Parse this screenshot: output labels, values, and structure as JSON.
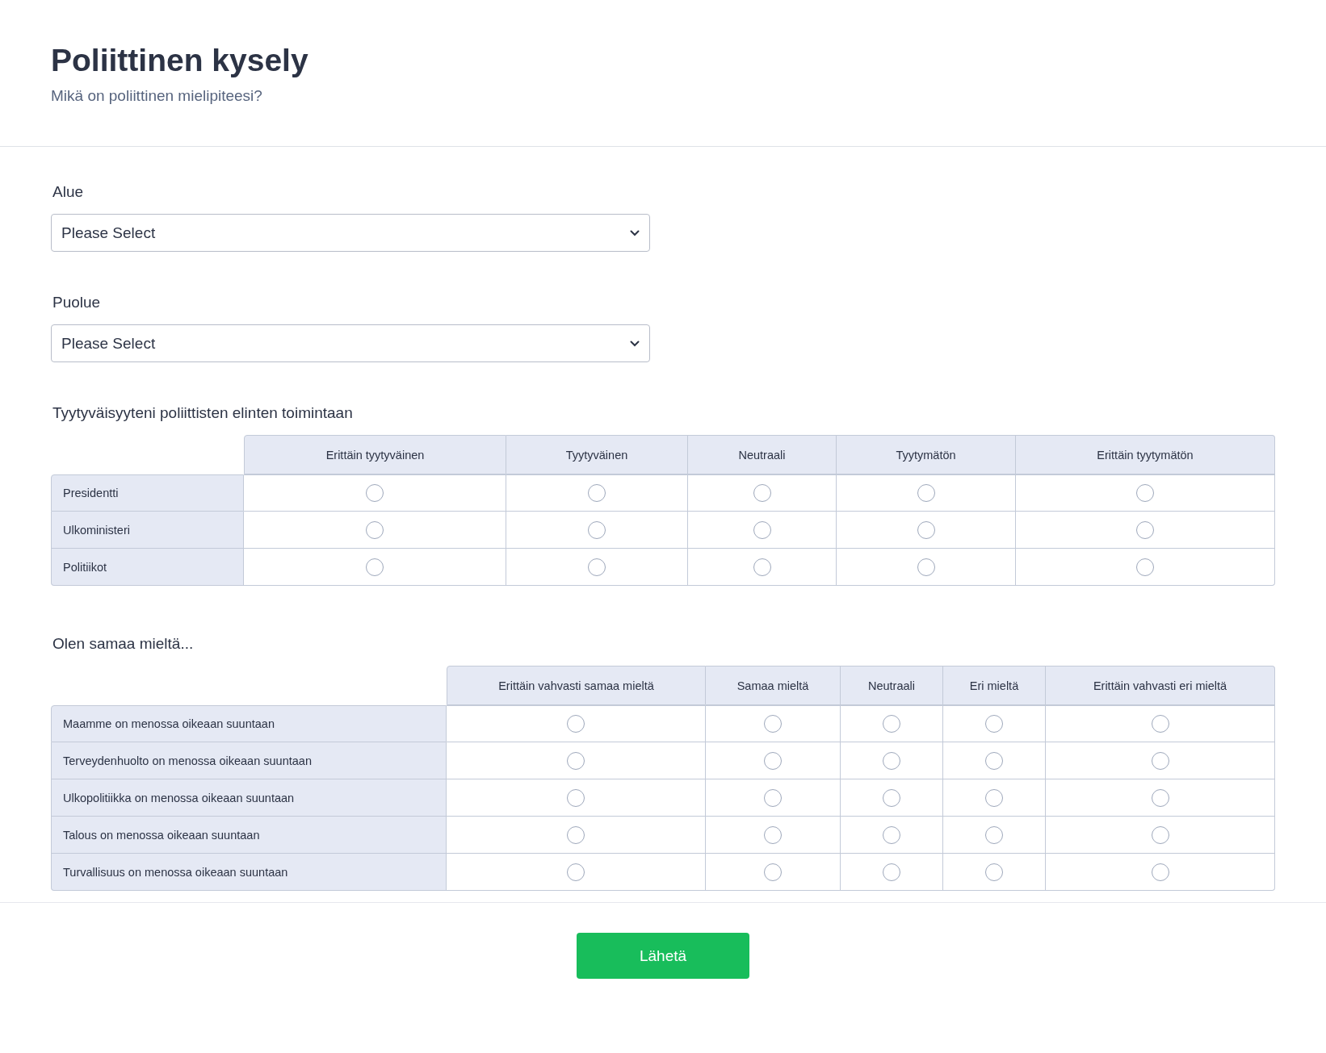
{
  "header": {
    "title": "Poliittinen kysely",
    "subtitle": "Mikä on poliittinen mielipiteesi?"
  },
  "dropdowns": [
    {
      "label": "Alue",
      "value": "Please Select"
    },
    {
      "label": "Puolue",
      "value": "Please Select"
    }
  ],
  "matrices": [
    {
      "title": "Tyytyväisyyteni poliittisten elinten toimintaan",
      "columns": [
        "Erittäin tyytyväinen",
        "Tyytyväinen",
        "Neutraali",
        "Tyytymätön",
        "Erittäin tyytymätön"
      ],
      "rows": [
        {
          "label": "Presidentti",
          "options": [
            {
              "selected": false
            },
            {
              "selected": false
            },
            {
              "selected": false
            },
            {
              "selected": false
            },
            {
              "selected": false
            }
          ]
        },
        {
          "label": "Ulkoministeri",
          "options": [
            {
              "selected": false
            },
            {
              "selected": false
            },
            {
              "selected": false
            },
            {
              "selected": false
            },
            {
              "selected": false
            }
          ]
        },
        {
          "label": "Politiikot",
          "options": [
            {
              "selected": false
            },
            {
              "selected": false
            },
            {
              "selected": false
            },
            {
              "selected": false
            },
            {
              "selected": false
            }
          ]
        }
      ]
    },
    {
      "title": "Olen samaa mieltä...",
      "columns": [
        "Erittäin vahvasti samaa mieltä",
        "Samaa mieltä",
        "Neutraali",
        "Eri mieltä",
        "Erittäin vahvasti eri mieltä"
      ],
      "rows": [
        {
          "label": "Maamme on menossa oikeaan suuntaan",
          "options": [
            {
              "selected": false
            },
            {
              "selected": false
            },
            {
              "selected": false
            },
            {
              "selected": false
            },
            {
              "selected": false
            }
          ]
        },
        {
          "label": "Terveydenhuolto on menossa oikeaan suuntaan",
          "options": [
            {
              "selected": false
            },
            {
              "selected": false
            },
            {
              "selected": false
            },
            {
              "selected": false
            },
            {
              "selected": false
            }
          ]
        },
        {
          "label": "Ulkopolitiikka on menossa oikeaan suuntaan",
          "options": [
            {
              "selected": false
            },
            {
              "selected": false
            },
            {
              "selected": false
            },
            {
              "selected": false
            },
            {
              "selected": false
            }
          ]
        },
        {
          "label": "Talous on menossa oikeaan suuntaan",
          "options": [
            {
              "selected": false
            },
            {
              "selected": false
            },
            {
              "selected": false
            },
            {
              "selected": false
            },
            {
              "selected": false
            }
          ]
        },
        {
          "label": "Turvallisuus on menossa oikeaan suuntaan",
          "options": [
            {
              "selected": false
            },
            {
              "selected": false
            },
            {
              "selected": false
            },
            {
              "selected": false
            },
            {
              "selected": false
            }
          ]
        }
      ]
    }
  ],
  "submit": {
    "label": "Lähetä"
  }
}
